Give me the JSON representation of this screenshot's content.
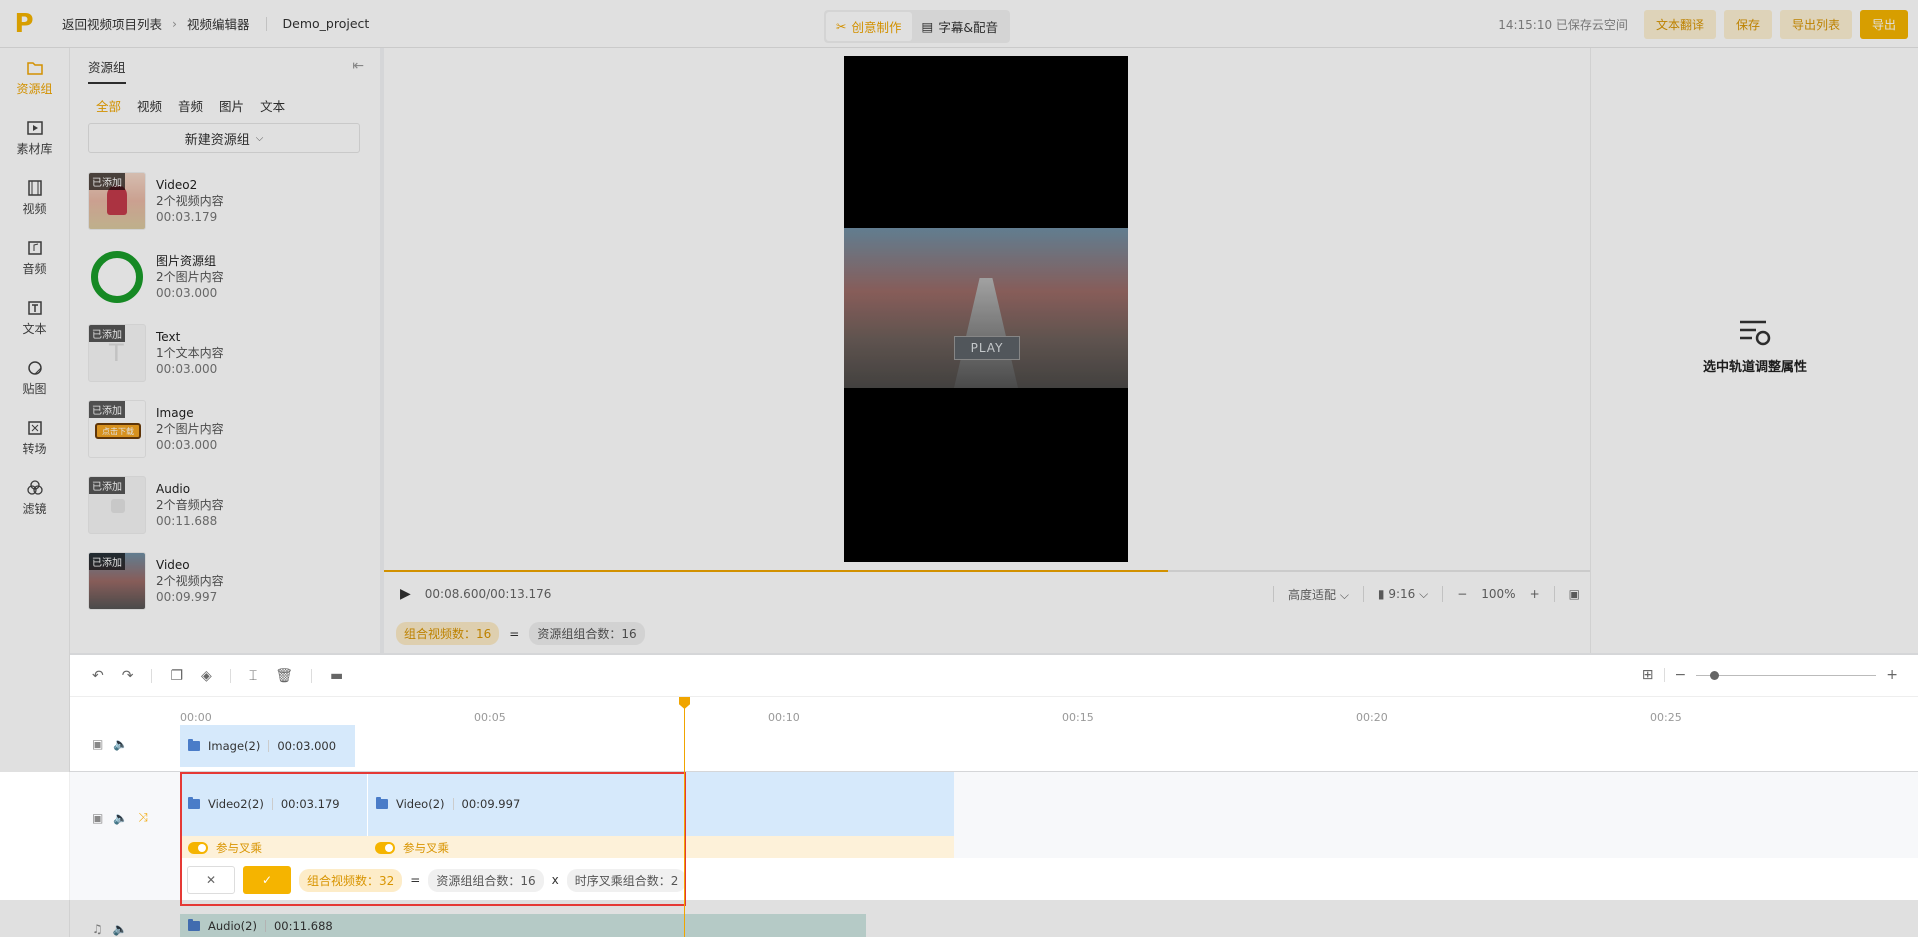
{
  "topbar": {
    "back_label": "返回视频项目列表",
    "editor_label": "视频编辑器",
    "project_name": "Demo_project",
    "mode_tabs": [
      "创意制作",
      "字幕&配音"
    ],
    "saved_status": "14:15:10 已保存云空间",
    "buttons": {
      "translate": "文本翻译",
      "save": "保存",
      "export_list": "导出列表",
      "export": "导出"
    }
  },
  "rail": [
    {
      "label": "资源组",
      "icon": "folder-icon"
    },
    {
      "label": "素材库",
      "icon": "play-square-icon"
    },
    {
      "label": "视频",
      "icon": "film-icon"
    },
    {
      "label": "音频",
      "icon": "music-icon"
    },
    {
      "label": "文本",
      "icon": "text-icon"
    },
    {
      "label": "贴图",
      "icon": "sticker-icon"
    },
    {
      "label": "转场",
      "icon": "transition-icon"
    },
    {
      "label": "滤镜",
      "icon": "filter-icon"
    }
  ],
  "panel": {
    "title": "资源组",
    "filters": [
      "全部",
      "视频",
      "音频",
      "图片",
      "文本"
    ],
    "new_group": "新建资源组",
    "added_tag": "已添加",
    "items": [
      {
        "name": "Video2",
        "summary": "2个视频内容",
        "duration": "00:03.179",
        "added": true
      },
      {
        "name": "图片资源组",
        "summary": "2个图片内容",
        "duration": "00:03.000",
        "added": false
      },
      {
        "name": "Text",
        "summary": "1个文本内容",
        "duration": "00:03.000",
        "added": true
      },
      {
        "name": "Image",
        "summary": "2个图片内容",
        "duration": "00:03.000",
        "added": true
      },
      {
        "name": "Audio",
        "summary": "2个音频内容",
        "duration": "00:11.688",
        "added": true
      },
      {
        "name": "Video",
        "summary": "2个视频内容",
        "duration": "00:09.997",
        "added": true
      }
    ],
    "image_badge": "点击下载"
  },
  "preview": {
    "play_text": "PLAY",
    "time": "00:08.600/00:13.176",
    "progress": 0.65,
    "fit_mode": "高度适配",
    "ratio": "9:16",
    "zoom": "100%",
    "combo_label": "组合视频数：16",
    "equals": "=",
    "group_combo": "资源组组合数：16"
  },
  "props": {
    "empty_text": "选中轨道调整属性"
  },
  "timeline": {
    "ticks": [
      "00:00",
      "00:05",
      "00:10",
      "00:15",
      "00:20",
      "00:25"
    ],
    "tracks": {
      "image": {
        "name": "Image(2)",
        "duration": "00:03.000"
      },
      "video_a": {
        "name": "Video2(2)",
        "duration": "00:03.179"
      },
      "video_b": {
        "name": "Video(2)",
        "duration": "00:09.997"
      },
      "audio": {
        "name": "Audio(2)",
        "duration": "00:11.688"
      }
    },
    "cross_label": "参与叉乘",
    "confirm": {
      "combo": "组合视频数：32",
      "equals": "=",
      "group_combo": "资源组组合数：16",
      "times": "x",
      "seq_combo": "时序叉乘组合数：2"
    }
  },
  "colors": {
    "accent": "#f5b400",
    "highlight": "#e53935",
    "clip_blue": "#d6e9fb"
  }
}
